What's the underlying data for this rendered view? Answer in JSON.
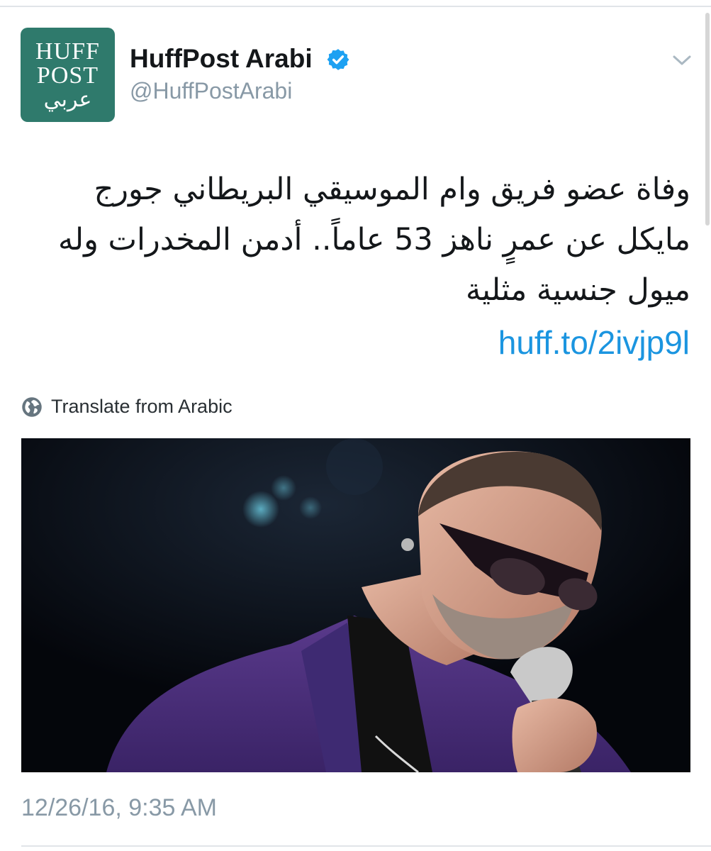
{
  "author": {
    "display_name": "HuffPost Arabi",
    "handle": "@HuffPostArabi",
    "avatar_logo": {
      "line1": "HUFF",
      "line2": "POST",
      "arabic": "عربي"
    },
    "verified_icon": "verified-badge-icon"
  },
  "menu_icon": "chevron-down-icon",
  "tweet": {
    "text": "وفاة عضو فريق وام الموسيقي البريطاني جورج مايكل عن عمرٍ ناهز 53 عاماً.. أدمن المخدرات وله ميول جنسية مثلية",
    "link": "huff.to/2ivjp9l"
  },
  "translate": {
    "icon": "globe-icon",
    "label": "Translate from Arabic"
  },
  "media": {
    "type": "photo"
  },
  "timestamp": "12/26/16, 9:35 AM",
  "colors": {
    "avatar_bg": "#2f7a6c",
    "link": "#1b95e0",
    "verified": "#1da1f2",
    "muted_text": "#8899a6",
    "text": "#14171a"
  }
}
